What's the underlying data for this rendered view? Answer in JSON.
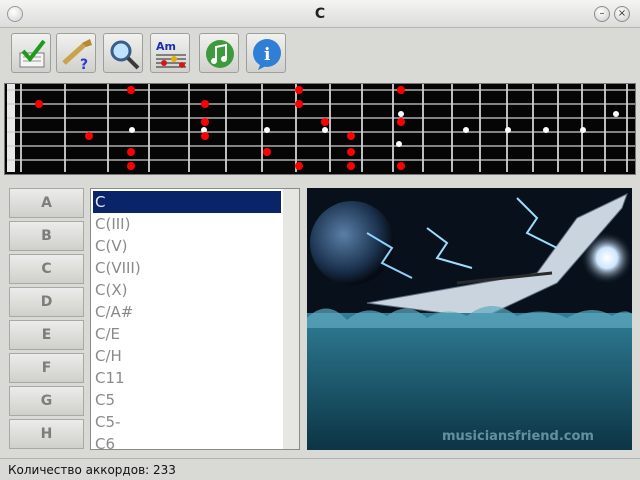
{
  "window": {
    "title": "C"
  },
  "toolbar": {
    "buttons": [
      {
        "name": "check-chord-button",
        "icon": "checkmark-chart-icon"
      },
      {
        "name": "guitar-quiz-button",
        "icon": "guitar-question-icon"
      },
      {
        "name": "search-button",
        "icon": "magnifier-icon"
      },
      {
        "name": "chord-notation-button",
        "icon": "am-notes-icon",
        "icon_text": "Am"
      },
      {
        "name": "play-sound-button",
        "icon": "music-note-icon"
      },
      {
        "name": "info-button",
        "icon": "info-icon"
      }
    ]
  },
  "letters": [
    "A",
    "B",
    "C",
    "D",
    "E",
    "F",
    "G",
    "H"
  ],
  "chords": {
    "selected": "C",
    "items": [
      "C",
      "C(III)",
      "C(V)",
      "C(VIII)",
      "C(X)",
      "C/A#",
      "C/E",
      "C/H",
      "C11",
      "C5",
      "C5-",
      "C6"
    ]
  },
  "artwork": {
    "watermark": "musiciansfriend.com"
  },
  "status": {
    "text": "Количество аккордов: 233"
  },
  "colors": {
    "accent": "#0a246a",
    "fret_dot": "#ff0000",
    "inlay": "#ffffff"
  }
}
